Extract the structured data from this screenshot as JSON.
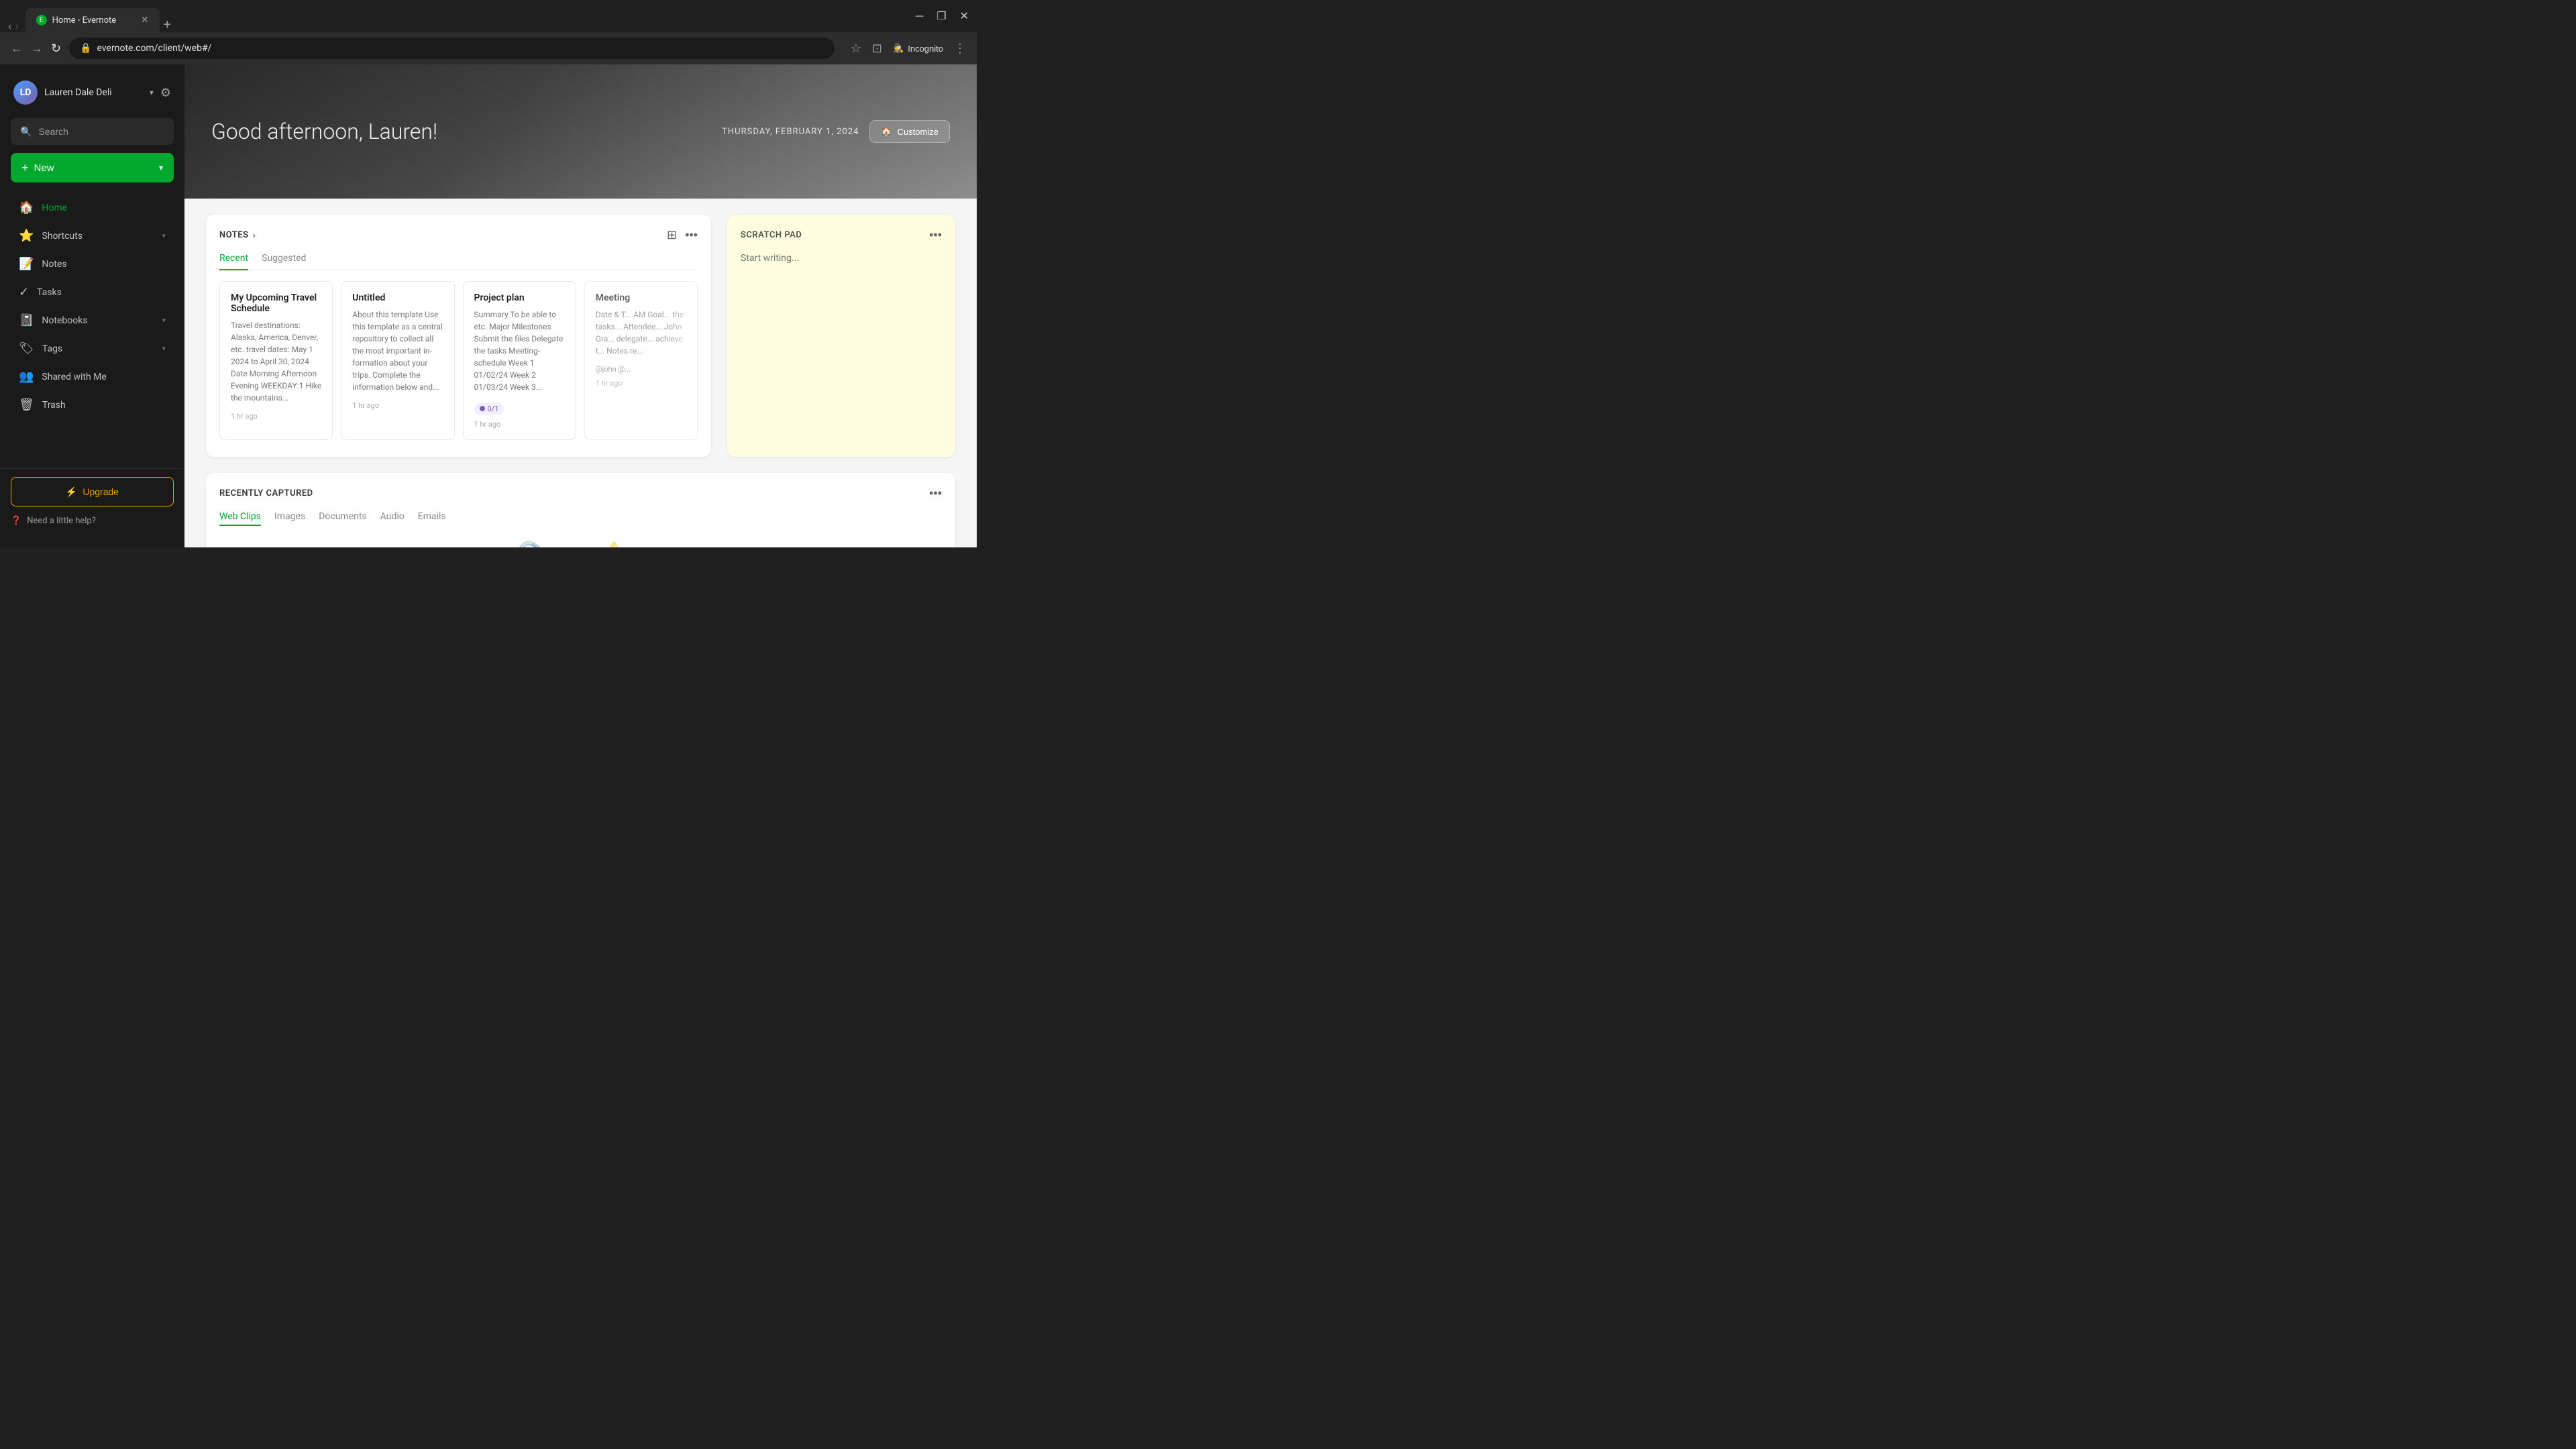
{
  "browser": {
    "tab_title": "Home - Evernote",
    "url": "evernote.com/client/web#/",
    "new_tab_label": "+",
    "incognito_label": "Incognito"
  },
  "sidebar": {
    "user_name": "Lauren Dale Deli",
    "user_initials": "LD",
    "search_label": "Search",
    "new_label": "New",
    "nav_items": [
      {
        "id": "home",
        "label": "Home",
        "icon": "🏠"
      },
      {
        "id": "shortcuts",
        "label": "Shortcuts",
        "icon": "⭐"
      },
      {
        "id": "notes",
        "label": "Notes",
        "icon": "📝"
      },
      {
        "id": "tasks",
        "label": "Tasks",
        "icon": "✓"
      },
      {
        "id": "notebooks",
        "label": "Notebooks",
        "icon": "📓"
      },
      {
        "id": "tags",
        "label": "Tags",
        "icon": "🏷"
      },
      {
        "id": "shared",
        "label": "Shared with Me",
        "icon": "👥"
      },
      {
        "id": "trash",
        "label": "Trash",
        "icon": "🗑"
      }
    ],
    "upgrade_label": "Upgrade",
    "help_label": "Need a little help?"
  },
  "hero": {
    "greeting": "Good afternoon, Lauren!",
    "date": "THURSDAY, FEBRUARY 1, 2024",
    "customize_label": "Customize"
  },
  "notes_widget": {
    "title": "NOTES",
    "tabs": [
      "Recent",
      "Suggested"
    ],
    "active_tab": "Recent",
    "notes": [
      {
        "title": "My Upcoming Travel Schedule",
        "preview": "Travel destinations: Alaska, America, Denver, etc. travel dates: May 1 2024 to April 30, 2024 Date Morning Afternoon Evening WEEKDAY:1 Hike the mountains...",
        "time": "1 hr ago",
        "badge": null,
        "mention": null
      },
      {
        "title": "Untitled",
        "preview": "About this template Use this template as a central repository to collect all the most important in-formation about your trips. Complete the information below and...",
        "time": "1 hr ago",
        "badge": null,
        "mention": null
      },
      {
        "title": "Project plan",
        "preview": "Summary To be able to etc. Major Milestones Submit the files Delegate the tasks Meeting-schedule Week 1 01/02/24 Week 2 01/03/24 Week 3...",
        "time": "1 hr ago",
        "badge": "0/1",
        "mention": null
      },
      {
        "title": "Meeting",
        "preview": "Date & T... AM Goal... the tasks... Attendee... John Gra... delegate... achieve t... Notes re...",
        "time": "1 hr ago",
        "badge": null,
        "mention": "@john @..."
      }
    ]
  },
  "scratch_pad": {
    "title": "SCRATCH PAD",
    "placeholder": "Start writing..."
  },
  "recently_captured": {
    "title": "RECENTLY CAPTURED",
    "tabs": [
      "Web Clips",
      "Images",
      "Documents",
      "Audio",
      "Emails"
    ],
    "active_tab": "Web Clips"
  }
}
